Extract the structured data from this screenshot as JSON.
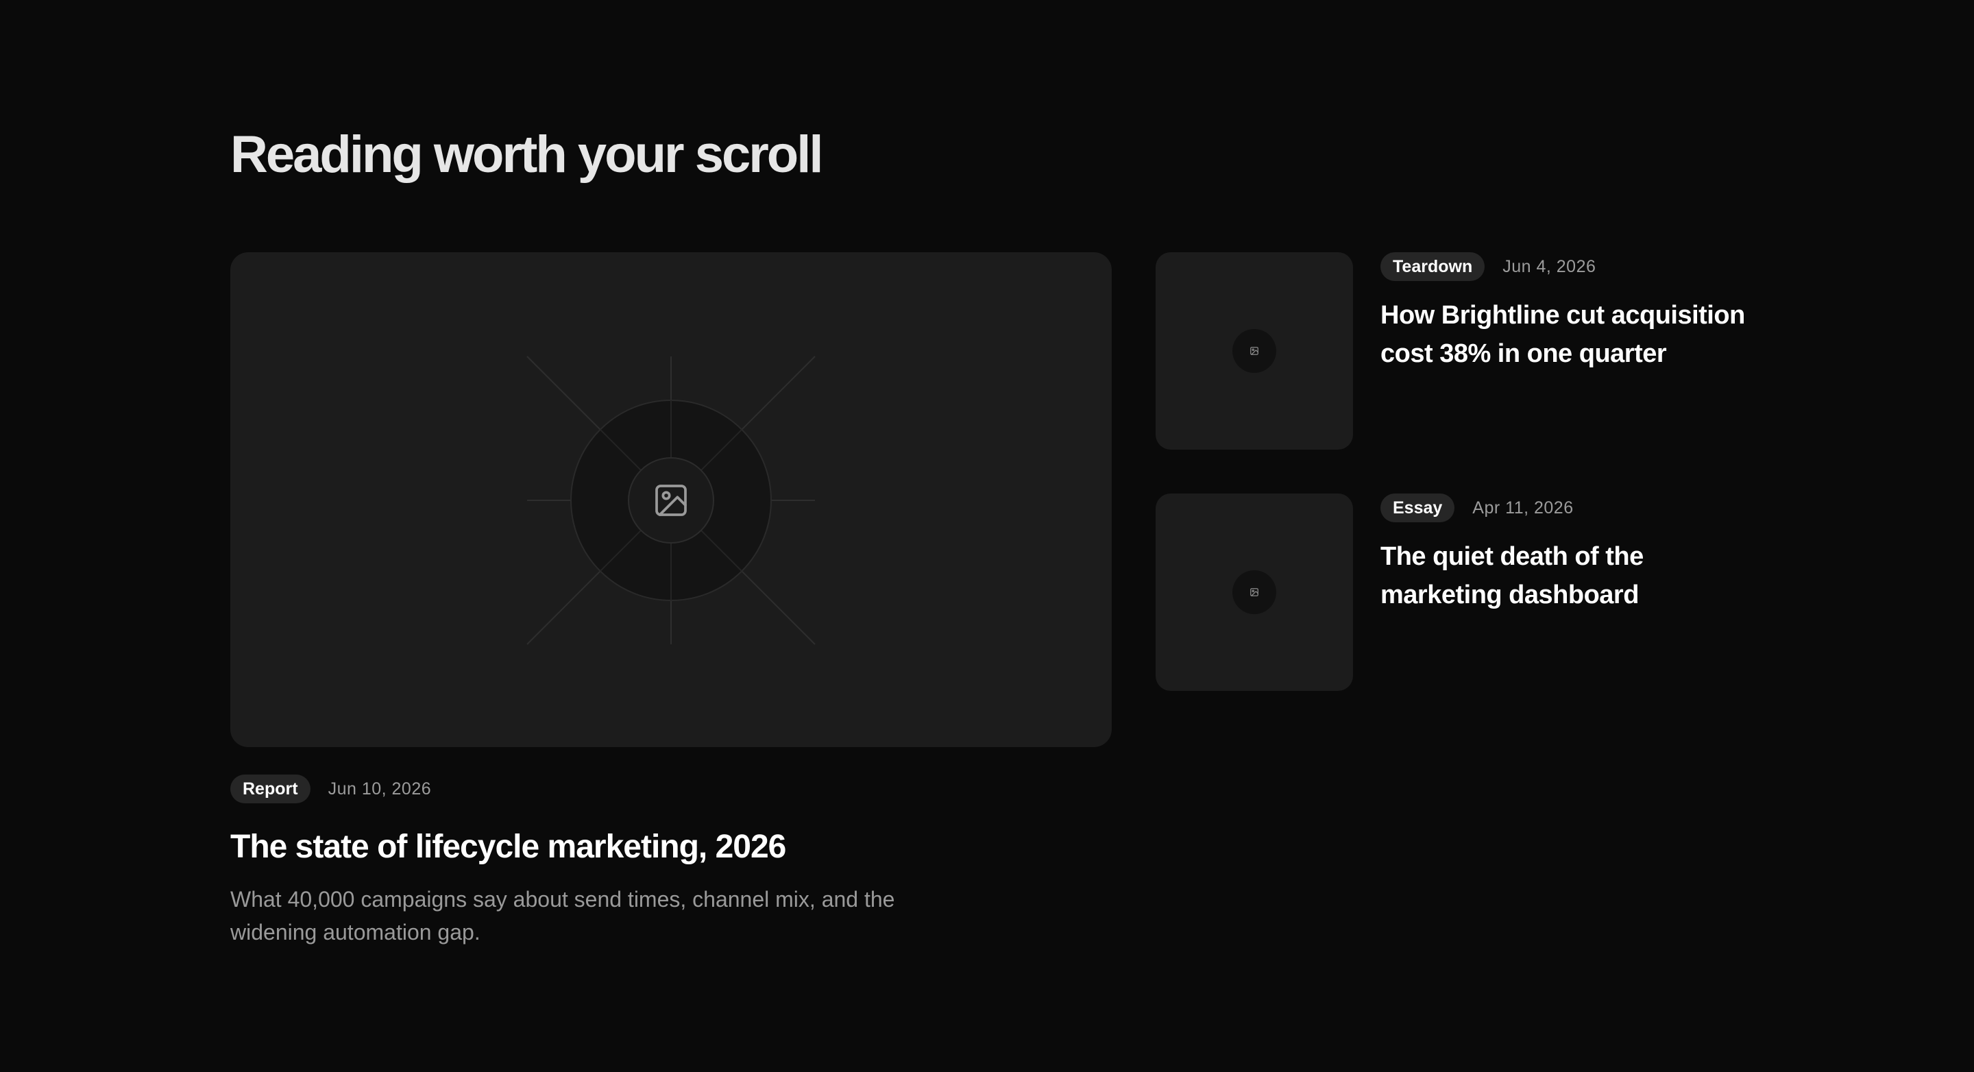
{
  "section": {
    "title": "Reading worth your scroll"
  },
  "featured": {
    "image_icon": "image-icon",
    "tag": "Report",
    "date": "Jun 10, 2026",
    "title": "The state of lifecycle marketing, 2026",
    "excerpt": "What 40,000 campaigns say about send times, channel mix, and the widening automation gap."
  },
  "articles": [
    {
      "tag": "Teardown",
      "date": "Jun 4, 2026",
      "title": "How Brightline cut acquisition cost 38% in one quarter",
      "thumb_icon": "image-icon"
    },
    {
      "tag": "Essay",
      "date": "Apr 11, 2026",
      "title": "The quiet death of the marketing dashboard",
      "thumb_icon": "image-icon"
    }
  ],
  "colors": {
    "background": "#0a0a0a",
    "card": "#1c1c1c",
    "badge": "#262626",
    "muted_text": "#9c9c9c"
  }
}
